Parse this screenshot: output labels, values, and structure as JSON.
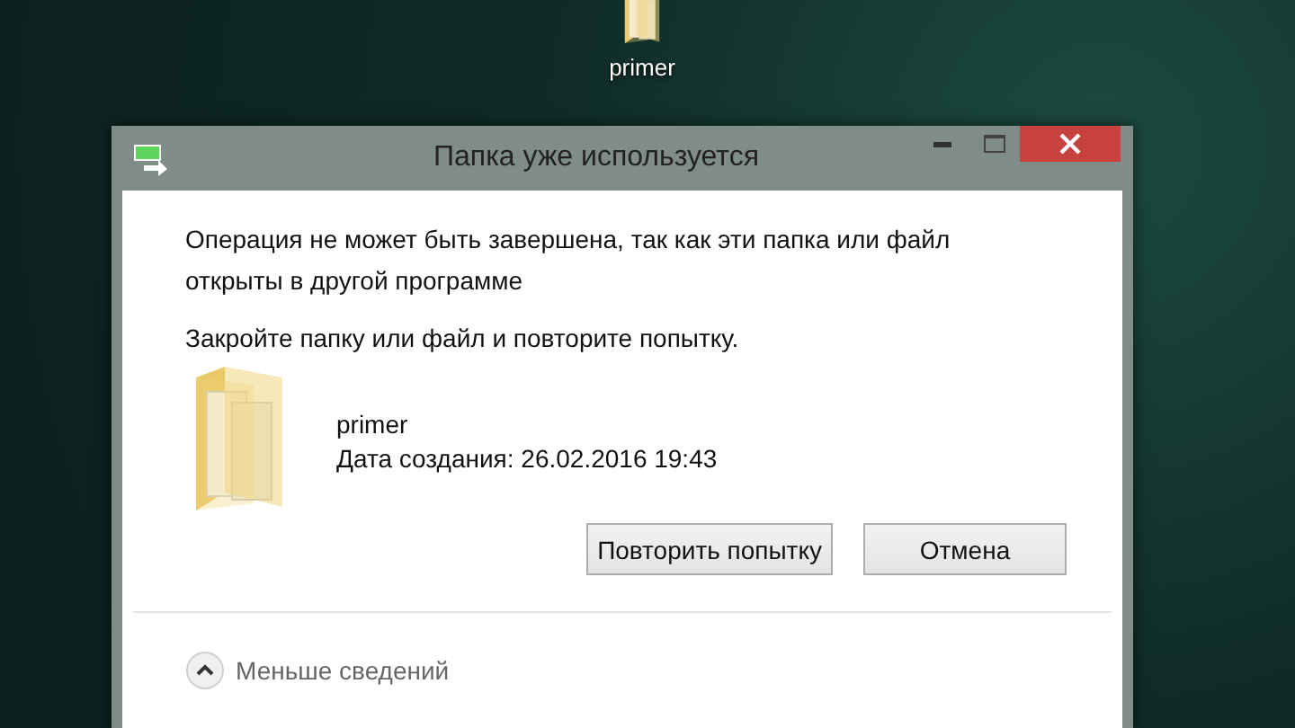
{
  "desktop_icon": {
    "label": "primer"
  },
  "dialog": {
    "title": "Папка уже используется",
    "message": "Операция не может быть завершена, так как эти папка или файл открыты в другой программе",
    "instruction": "Закройте папку или файл и повторите попытку.",
    "file": {
      "name": "primer",
      "created": "Дата создания: 26.02.2016 19:43"
    },
    "buttons": [
      "Повторить попытку",
      "Отмена"
    ],
    "details_toggle": {
      "label": "Меньше сведений",
      "expanded": true
    }
  }
}
